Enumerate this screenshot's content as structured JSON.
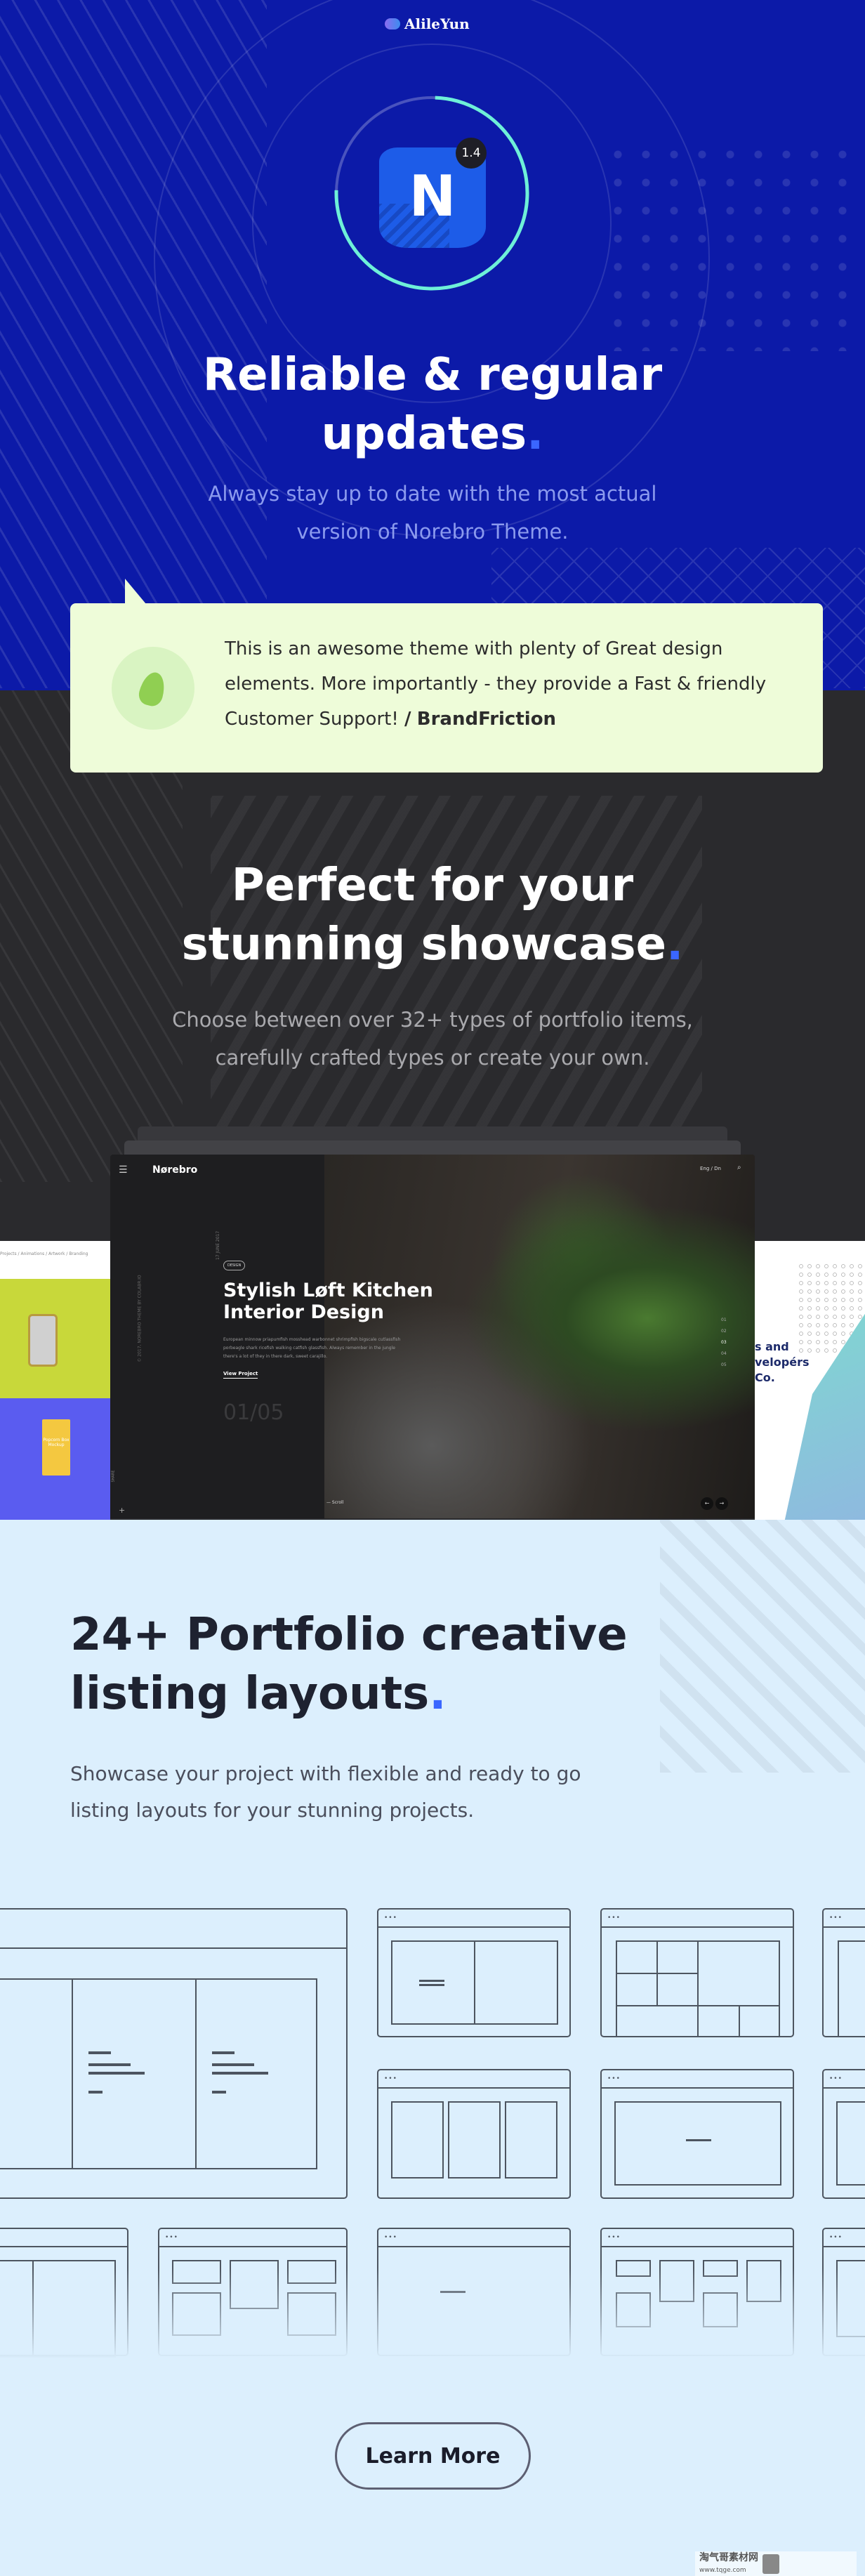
{
  "watermark_top": "AlileYun",
  "updates": {
    "version_badge": "1.4",
    "logo_letter": "N",
    "title_line1": "Reliable & regular",
    "title_line2": "updates",
    "title_dot": ".",
    "subtitle_line1": "Always stay up to date with the most actual",
    "subtitle_line2": "version of Norebro Theme.",
    "ring_color": "#6ef0d8",
    "bg_color": "#0c1aa8"
  },
  "testimonial": {
    "text": "This is an awesome theme with plenty of Great design elements. More importantly - they provide a Fast & friendly Customer Support!",
    "separator": "/",
    "author": "BrandFriction",
    "icon": "envato-leaf-icon"
  },
  "showcase": {
    "title_line1": "Perfect for your",
    "title_line2": "stunning showcase",
    "title_dot": ".",
    "subtitle_line1": "Choose between over 32+ types of portfolio items,",
    "subtitle_line2": "carefully crafted types or create your own.",
    "mockup": {
      "brand": "Nørebro",
      "lang": "Eng / Dn",
      "tag": "DESIGN",
      "date": "17 JUNE 2017",
      "side_text": "© 2017, NOREBRO THEME BY COLABR.IO",
      "title_line1": "Stylish Løft Kitchen",
      "title_line2": "Interior Design",
      "description": "European minnow priapumfish mosshead warbonnet shrimpfish bigscale cutlassfish porbeagle shark ricefish walking catfish glassfish. Always remember in the jungle there's a lot of they in there dark, sweet carajillo.",
      "cta": "View Project",
      "counter": "01/05",
      "pager": [
        "01",
        "02",
        "03",
        "04",
        "05"
      ],
      "scroll": "Scroll",
      "share": "SHARE",
      "left_filters": "Projects / Animations / Artwork / Branding",
      "popcorn": "Popcorn Box Mockup",
      "right_text_line1": "s and",
      "right_text_line2": "velopérs",
      "right_text_line3": "Co."
    }
  },
  "layouts": {
    "title_line1": "24+ Portfolio creative",
    "title_line2": "listing layouts",
    "title_dot": ".",
    "subtitle_line1": "Showcase your project with flexible and ready to go",
    "subtitle_line2": "listing layouts for your stunning projects.",
    "window_dots": "•••",
    "learn_more": "Learn More"
  },
  "watermark_bottom": {
    "name": "淘气哥素材网",
    "url": "www.tqge.com"
  }
}
